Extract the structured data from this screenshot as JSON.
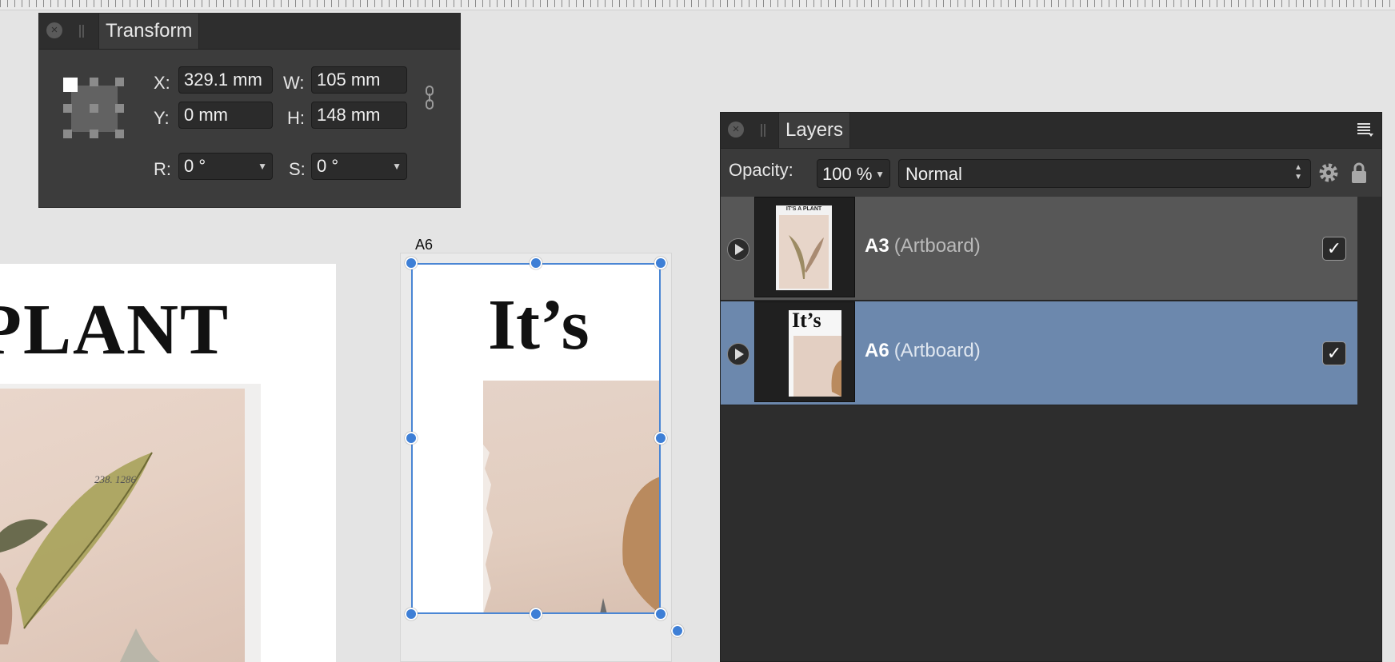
{
  "transform": {
    "tab_label": "Transform",
    "x_label": "X:",
    "x_value": "329.1 mm",
    "y_label": "Y:",
    "y_value": "0 mm",
    "w_label": "W:",
    "w_value": "105 mm",
    "h_label": "H:",
    "h_value": "148 mm",
    "r_label": "R:",
    "r_value": "0 °",
    "s_label": "S:",
    "s_value": "0 °"
  },
  "canvas": {
    "a3_title": "PLANT",
    "a3_numbers": "238.   1286",
    "a6_label": "A6",
    "a6_title": "It’s"
  },
  "layers": {
    "tab_label": "Layers",
    "opacity_label": "Opacity:",
    "opacity_value": "100 %",
    "blend_mode": "Normal",
    "items": [
      {
        "name": "A3",
        "type": "(Artboard)",
        "thumb_text": "IT'S A PLANT",
        "visible": true
      },
      {
        "name": "A6",
        "type": "(Artboard)",
        "thumb_text": "It’s",
        "visible": true,
        "selected": true
      }
    ]
  },
  "colors": {
    "selection": "#4a86d4",
    "selected_row": "#6c88ad",
    "panel_bg": "#3c3c3c"
  }
}
